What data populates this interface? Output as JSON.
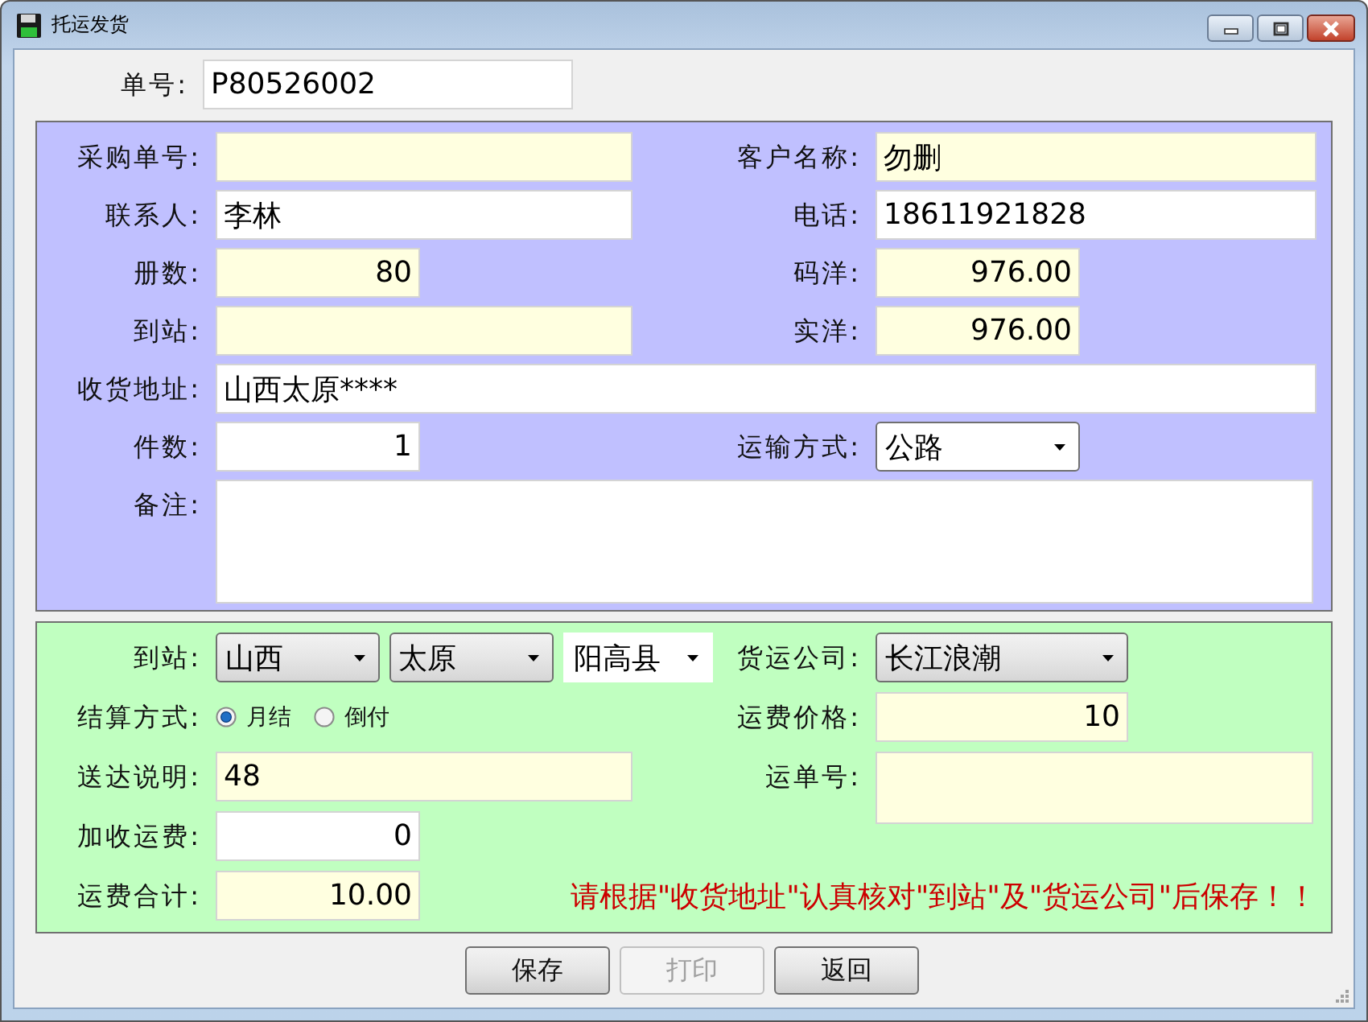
{
  "window": {
    "title": "托运发货"
  },
  "order_no": {
    "label": "单号:",
    "value": "P80526002",
    "readonly": false
  },
  "order_fields": [
    {
      "label": "采购单号:",
      "kind": "text",
      "readonly": true
    },
    {
      "label": "客户名称:",
      "kind": "text",
      "value": "勿删",
      "readonly": true
    },
    {
      "label": "联系人:",
      "kind": "text",
      "value": "李林",
      "readonly": false
    },
    {
      "label": "电话:",
      "kind": "text",
      "value": "18611921828",
      "readonly": false
    },
    {
      "label": "册数:",
      "kind": "number",
      "value": "80",
      "readonly": true
    },
    {
      "label": "码洋:",
      "kind": "number",
      "value": "976.00",
      "readonly": true
    },
    {
      "label": "到站:",
      "kind": "text",
      "readonly": true
    },
    {
      "label": "实洋:",
      "kind": "number",
      "value": "976.00",
      "readonly": true
    },
    {
      "label": "收货地址:",
      "kind": "wide-text",
      "value": "山西太原****",
      "readonly": false
    },
    {
      "label": "件数:",
      "kind": "number",
      "value": "1",
      "readonly": false
    },
    {
      "label": "运输方式:",
      "kind": "select",
      "value": "公路",
      "readonly": false
    },
    {
      "label": "备注:",
      "kind": "memo",
      "readonly": false
    }
  ],
  "shipping": {
    "destination": {
      "label": "到站:",
      "province": "山西",
      "city": "太原",
      "county": "阳高县"
    },
    "carrier": {
      "label": "货运公司:",
      "value": "长江浪潮"
    },
    "settlement": {
      "label": "结算方式:",
      "options": [
        {
          "label": "月结",
          "selected": true
        },
        {
          "label": "倒付",
          "selected": false
        }
      ]
    },
    "freight_price": {
      "label": "运费价格:",
      "value": "10",
      "readonly": true
    },
    "delivery_note": {
      "label": "送达说明:",
      "value": "48",
      "readonly": true
    },
    "waybill_no": {
      "label": "运单号:",
      "readonly": true
    },
    "extra_fee": {
      "label": "加收运费:",
      "value": "0",
      "readonly": false
    },
    "freight_total": {
      "label": "运费合计:",
      "value": "10.00",
      "readonly": true
    },
    "notice": "请根据\"收货地址\"认真核对\"到站\"及\"货运公司\"后保存！！"
  },
  "buttons": [
    {
      "label": "保存",
      "disabled": false
    },
    {
      "label": "打印",
      "disabled": true
    },
    {
      "label": "返回",
      "disabled": false
    }
  ]
}
